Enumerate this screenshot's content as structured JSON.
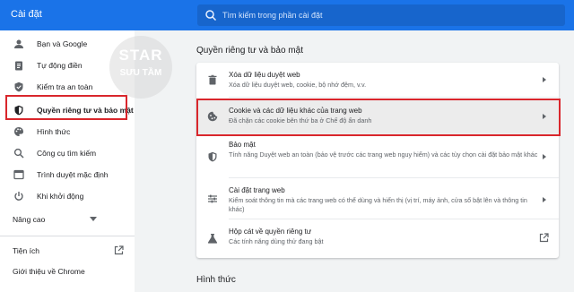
{
  "app_title": "Cài đặt",
  "search": {
    "placeholder": "Tìm kiếm trong phần cài đặt"
  },
  "sidebar": {
    "items": [
      {
        "label": "Bạn và Google",
        "icon": "person-icon"
      },
      {
        "label": "Tự động điền",
        "icon": "clipboard-icon"
      },
      {
        "label": "Kiểm tra an toàn",
        "icon": "shield-check-icon"
      },
      {
        "label": "Quyền riêng tư và bảo mật",
        "icon": "shield-icon",
        "active": true
      },
      {
        "label": "Hình thức",
        "icon": "palette-icon"
      },
      {
        "label": "Công cụ tìm kiếm",
        "icon": "search-icon"
      },
      {
        "label": "Trình duyệt mặc định",
        "icon": "browser-icon"
      },
      {
        "label": "Khi khởi động",
        "icon": "power-icon"
      }
    ],
    "advanced": "Nâng cao",
    "extensions": "Tiện ích",
    "about": "Giới thiệu về Chrome"
  },
  "watermark": {
    "line1": "STAR",
    "line2": "SƯU TẦM"
  },
  "main": {
    "section_title": "Quyền riêng tư và bảo mật",
    "rows": [
      {
        "title": "Xóa dữ liệu duyệt web",
        "subtitle": "Xóa dữ liệu duyệt web, cookie, bộ nhớ đệm, v.v.",
        "icon": "trash-icon"
      },
      {
        "title": "Cookie và các dữ liệu khác của trang web",
        "subtitle": "Đã chặn các cookie bên thứ ba ở Chế độ ẩn danh",
        "icon": "cookie-icon"
      },
      {
        "title": "Bảo mật",
        "subtitle": "Tính năng Duyệt web an toàn (bảo vệ trước các trang web nguy hiểm) và các tùy chọn cài đặt bảo mật khác",
        "icon": "shield-icon"
      },
      {
        "title": "Cài đặt trang web",
        "subtitle": "Kiểm soát thông tin mà các trang web có thể dùng và hiển thị (vị trí, máy ảnh, cửa sổ bật lên và thông tin khác)",
        "icon": "sliders-icon"
      },
      {
        "title": "Hộp cát về quyền riêng tư",
        "subtitle": "Các tính năng dùng thử đang bật",
        "icon": "flask-icon"
      }
    ],
    "next_section_title": "Hình thức"
  },
  "colors": {
    "accent": "#1a73e8",
    "highlight_border": "#d9262c",
    "background": "#f1f3f4"
  }
}
